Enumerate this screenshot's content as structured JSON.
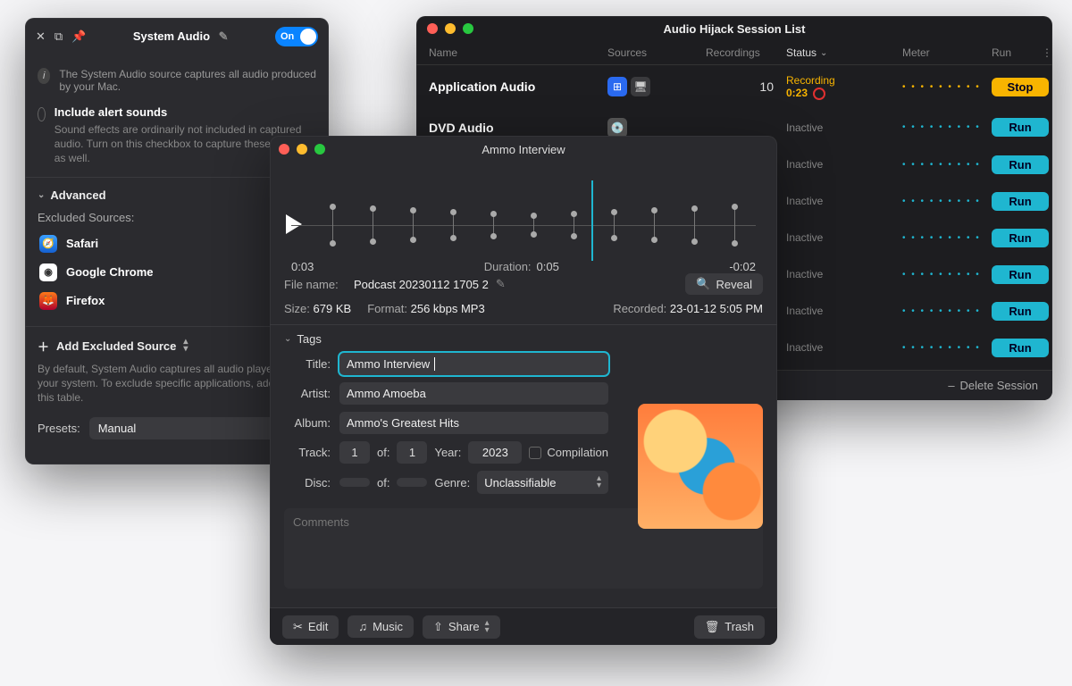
{
  "session_list": {
    "title": "Audio Hijack Session List",
    "columns": {
      "name": "Name",
      "sources": "Sources",
      "recordings": "Recordings",
      "status": "Status",
      "meter": "Meter",
      "run": "Run"
    },
    "rows": [
      {
        "name": "Application Audio",
        "recordings": "10",
        "status": "Recording",
        "time": "0:23",
        "active": true,
        "run_label": "Stop"
      },
      {
        "name": "DVD Audio",
        "recordings": "",
        "status": "Inactive",
        "active": false,
        "run_label": "Run"
      },
      {
        "name": "",
        "status": "Inactive",
        "active": false,
        "run_label": "Run"
      },
      {
        "name": "",
        "status": "Inactive",
        "active": false,
        "run_label": "Run"
      },
      {
        "name": "",
        "status": "Inactive",
        "active": false,
        "run_label": "Run"
      },
      {
        "name": "",
        "status": "Inactive",
        "active": false,
        "run_label": "Run"
      },
      {
        "name": "",
        "status": "Inactive",
        "active": false,
        "run_label": "Run"
      },
      {
        "name": "",
        "status": "Inactive",
        "active": false,
        "run_label": "Run"
      }
    ],
    "footer": {
      "delete": "Delete Session"
    }
  },
  "sysaudio": {
    "title": "System Audio",
    "toggle": "On",
    "info": "The System Audio source captures all audio produced by your Mac.",
    "include_label": "Include alert sounds",
    "include_sub": "Sound effects are ordinarily not included in captured audio. Turn on this checkbox to capture these sounds as well.",
    "advanced": "Advanced",
    "excluded_label": "Excluded Sources:",
    "excluded": [
      "Safari",
      "Google Chrome",
      "Firefox"
    ],
    "add_label": "Add Excluded Source",
    "bydefault": "By default, System Audio captures all audio played on your system. To exclude specific applications, add them to this table.",
    "presets_label": "Presets:",
    "presets_value": "Manual"
  },
  "inspector": {
    "title": "Ammo Interview",
    "time_elapsed": "0:03",
    "duration_label": "Duration:",
    "duration_value": "0:05",
    "time_remain": "-0:02",
    "file": {
      "name_label": "File name:",
      "name": "Podcast 20230112 1705 2",
      "size_label": "Size:",
      "size": "679 KB",
      "format_label": "Format:",
      "format": "256 kbps MP3",
      "recorded_label": "Recorded:",
      "recorded": "23-01-12 5:05 PM",
      "reveal": "Reveal"
    },
    "tags": {
      "header": "Tags",
      "title_label": "Title:",
      "title": "Ammo Interview",
      "artist_label": "Artist:",
      "artist": "Ammo Amoeba",
      "album_label": "Album:",
      "album": "Ammo's Greatest Hits",
      "track_label": "Track:",
      "track": "1",
      "of_label": "of:",
      "track_of": "1",
      "year_label": "Year:",
      "year": "2023",
      "compilation": "Compilation",
      "disc_label": "Disc:",
      "genre_label": "Genre:",
      "genre": "Unclassifiable",
      "comments_placeholder": "Comments"
    },
    "footer": {
      "edit": "Edit",
      "music": "Music",
      "share": "Share",
      "trash": "Trash"
    }
  }
}
